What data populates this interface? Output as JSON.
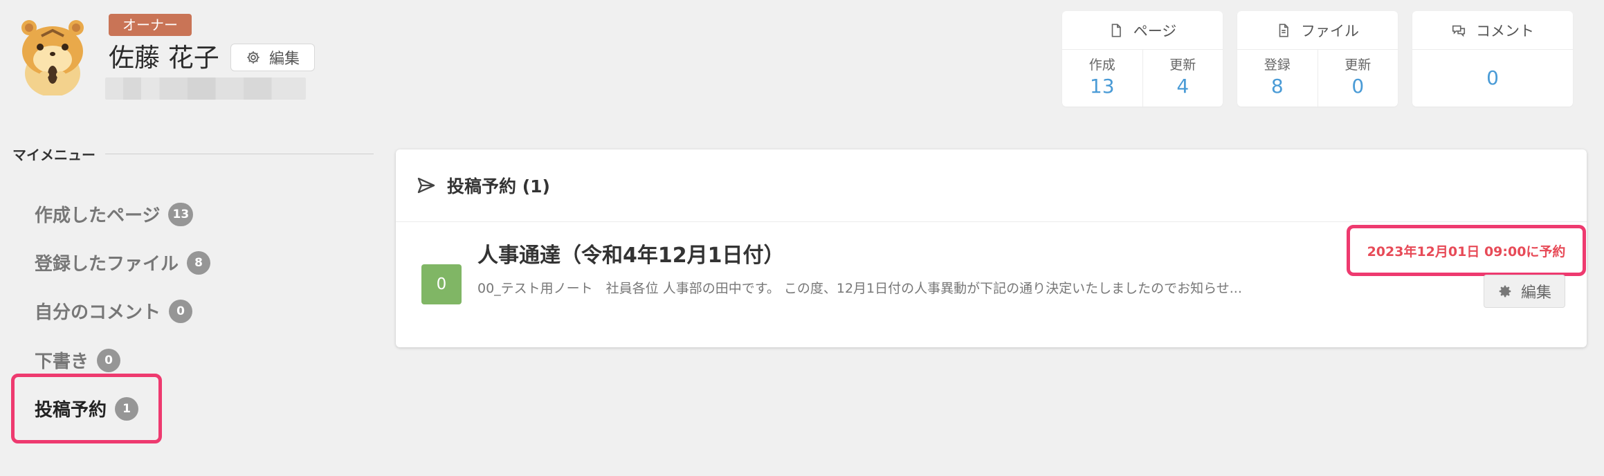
{
  "profile": {
    "role_badge": "オーナー",
    "name": "佐藤 花子",
    "edit_label": "編集"
  },
  "stats": {
    "pages": {
      "title": "ページ",
      "created_label": "作成",
      "created_value": "13",
      "updated_label": "更新",
      "updated_value": "4"
    },
    "files": {
      "title": "ファイル",
      "registered_label": "登録",
      "registered_value": "8",
      "updated_label": "更新",
      "updated_value": "0"
    },
    "comments": {
      "title": "コメント",
      "value": "0"
    }
  },
  "sidebar": {
    "title": "マイメニュー",
    "items": [
      {
        "label": "作成したページ",
        "count": "13"
      },
      {
        "label": "登録したファイル",
        "count": "8"
      },
      {
        "label": "自分のコメント",
        "count": "0"
      },
      {
        "label": "下書き",
        "count": "0"
      },
      {
        "label": "投稿予約",
        "count": "1"
      }
    ]
  },
  "panel": {
    "title": "投稿予約 (1)",
    "entry": {
      "comment_count": "0",
      "title": "人事通達（令和4年12月1日付）",
      "excerpt": "00_テスト用ノート　社員各位 人事部の田中です。 この度、12月1日付の人事異動が下記の通り決定いたしましたのでお知らせ...",
      "schedule": "2023年12月01日 09:00に予約",
      "edit_label": "編集"
    }
  },
  "colors": {
    "accent": "#4a9bd6",
    "owner_badge": "#c97456",
    "highlight": "#ee3a6f",
    "schedule_text": "#e74a57",
    "comment_box": "#80b665"
  }
}
